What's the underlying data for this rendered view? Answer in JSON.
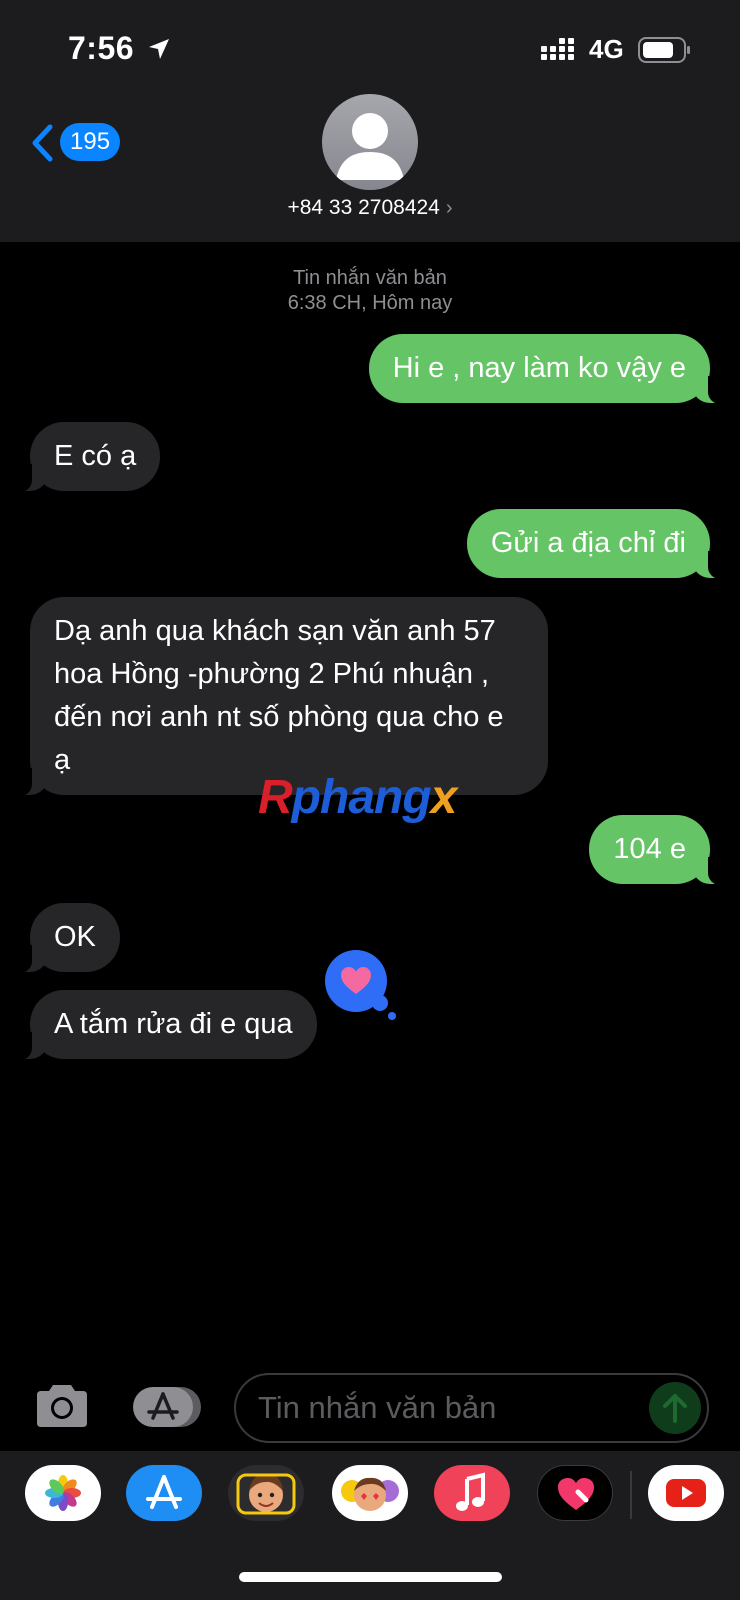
{
  "status_bar": {
    "time": "7:56",
    "network": "4G"
  },
  "header": {
    "back_count": "195",
    "contact": "+84 33 2708424",
    "contact_chevron": "›"
  },
  "conversation": {
    "service": "Tin nhắn văn bản",
    "timestamp": "6:38 CH, Hôm nay",
    "messages": [
      {
        "direction": "out",
        "text": "Hi e , nay làm ko vậy e"
      },
      {
        "direction": "in",
        "text": "E có ạ"
      },
      {
        "direction": "out",
        "text": "Gửi a địa chỉ đi"
      },
      {
        "direction": "in",
        "text": "Dạ anh qua khách sạn văn anh 57 hoa Hồng -phường 2 Phú nhuận , đến nơi anh nt số phòng qua cho e ạ"
      },
      {
        "direction": "out",
        "text": "104 e"
      },
      {
        "direction": "in",
        "text": "OK"
      },
      {
        "direction": "in",
        "text": "A tắm rửa đi e qua",
        "reaction": "heart-icon"
      }
    ]
  },
  "watermark": {
    "part1": "R",
    "part2": "phang",
    "part3": "x"
  },
  "compose": {
    "placeholder": "Tin nhắn văn bản"
  },
  "app_drawer": [
    "photos-app-icon",
    "app-store-app-icon",
    "memoji-app-icon",
    "animoji-stickers-app-icon",
    "music-app-icon",
    "digital-touch-app-icon",
    "youtube-app-icon"
  ],
  "colors": {
    "sent_bubble": "#65c466",
    "received_bubble": "#262628",
    "accent": "#0a84ff"
  }
}
